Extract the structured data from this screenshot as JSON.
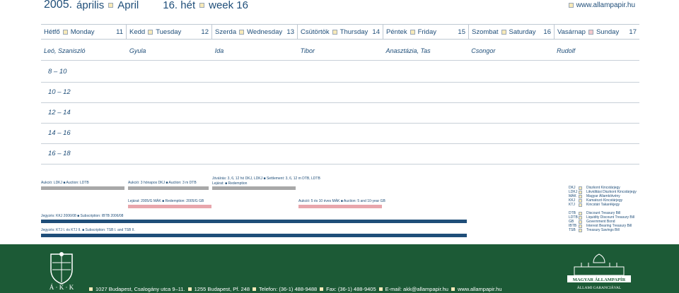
{
  "header": {
    "year": "2005.",
    "month_hu": "április",
    "month_en": "April",
    "week_num": "16. hét",
    "week_en": "week 16",
    "website": "www.allampapir.hu"
  },
  "days": [
    {
      "hu": "Hétfő",
      "en": "Monday",
      "num": "11"
    },
    {
      "hu": "Kedd",
      "en": "Tuesday",
      "num": "12"
    },
    {
      "hu": "Szerda",
      "en": "Wednesday",
      "num": "13"
    },
    {
      "hu": "Csütörtök",
      "en": "Thursday",
      "num": "14"
    },
    {
      "hu": "Péntek",
      "en": "Friday",
      "num": "15"
    },
    {
      "hu": "Szombat",
      "en": "Saturday",
      "num": "16"
    },
    {
      "hu": "Vasárnap",
      "en": "Sunday",
      "num": "17"
    }
  ],
  "namedays": [
    "Leó, Szaniszló",
    "Gyula",
    "Ida",
    "Tibor",
    "Anasztázia, Tas",
    "Csongor",
    "Rudolf"
  ],
  "timeslots": [
    "8 – 10",
    "10 – 12",
    "12 – 14",
    "14 – 16",
    "16 – 18"
  ],
  "events": {
    "auction_ldkj": "Aukció: LDKJ ■ Auction: LDTB",
    "auction_3m": "Aukció: 3 hónapos DKJ ■ Auction: 3 m DTB",
    "settlement": "Jóváírás: 3, 6, 12 hó DKJ, LDKJ ■ Settlement: 3, 6, 12 m DTB, LDTB",
    "lejarat_dkj": "Lejárat: ■ Redemption",
    "lejarat_2005": "Lejárat: 2005/G MÁK ■ Redemption: 2005/G GB",
    "auction_5_10": "Aukció: 5 és 10 éves MÁK ■ Auction: 5 and 10-year GB",
    "subscription_kkj": "Jegyzés: KKJ 2006/08 ■ Subscription: IBTB 2006/08",
    "subscription_ktj": "Jegyzés: KTJ I. és KTJ II. ■ Subscription: TSB I. and TSB II."
  },
  "legend": [
    {
      "abbr": "DKJ",
      "desc": "Diszkont Kincstárjegy"
    },
    {
      "abbr": "LDKJ",
      "desc": "Likviditási Diszkont Kincstárjegy"
    },
    {
      "abbr": "MÁK",
      "desc": "Magyar Államkötvény"
    },
    {
      "abbr": "KKJ",
      "desc": "Kamatozó Kincstárjegy"
    },
    {
      "abbr": "KTJ",
      "desc": "Kincstári Takarékjegy"
    },
    {
      "abbr": "DTB",
      "desc": "Discount Treasury Bill"
    },
    {
      "abbr": "LDTB",
      "desc": "Liquidity Discount Treasury Bill"
    },
    {
      "abbr": "GB",
      "desc": "Government Bond"
    },
    {
      "abbr": "IBTB",
      "desc": "Interest Bearing Treasury Bill"
    },
    {
      "abbr": "TSB",
      "desc": "Treasury Savings Bill"
    }
  ],
  "footer": {
    "logo_text": "Á · K · K",
    "address": "1027 Budapest, Csalogány utca 9–11.",
    "postal": "1255 Budapest, Pf. 248",
    "phone": "Telefon: (36-1) 488-9488",
    "fax": "Fax: (36-1) 488-9405",
    "email": "E-mail: akk@allampapir.hu",
    "website": "www.allampapir.hu",
    "right_logo_line1": "MAGYAR ÁLLAMPAPÍR",
    "right_logo_line2": "ÁLLAMI GARANCIÁVAL"
  },
  "colors": {
    "navy": "#1f4e79",
    "green": "#1c5a36",
    "grey_bar": "#a8a8a8",
    "pink_bar": "#e8a6ac",
    "cream_square": "#f7e9b8"
  }
}
